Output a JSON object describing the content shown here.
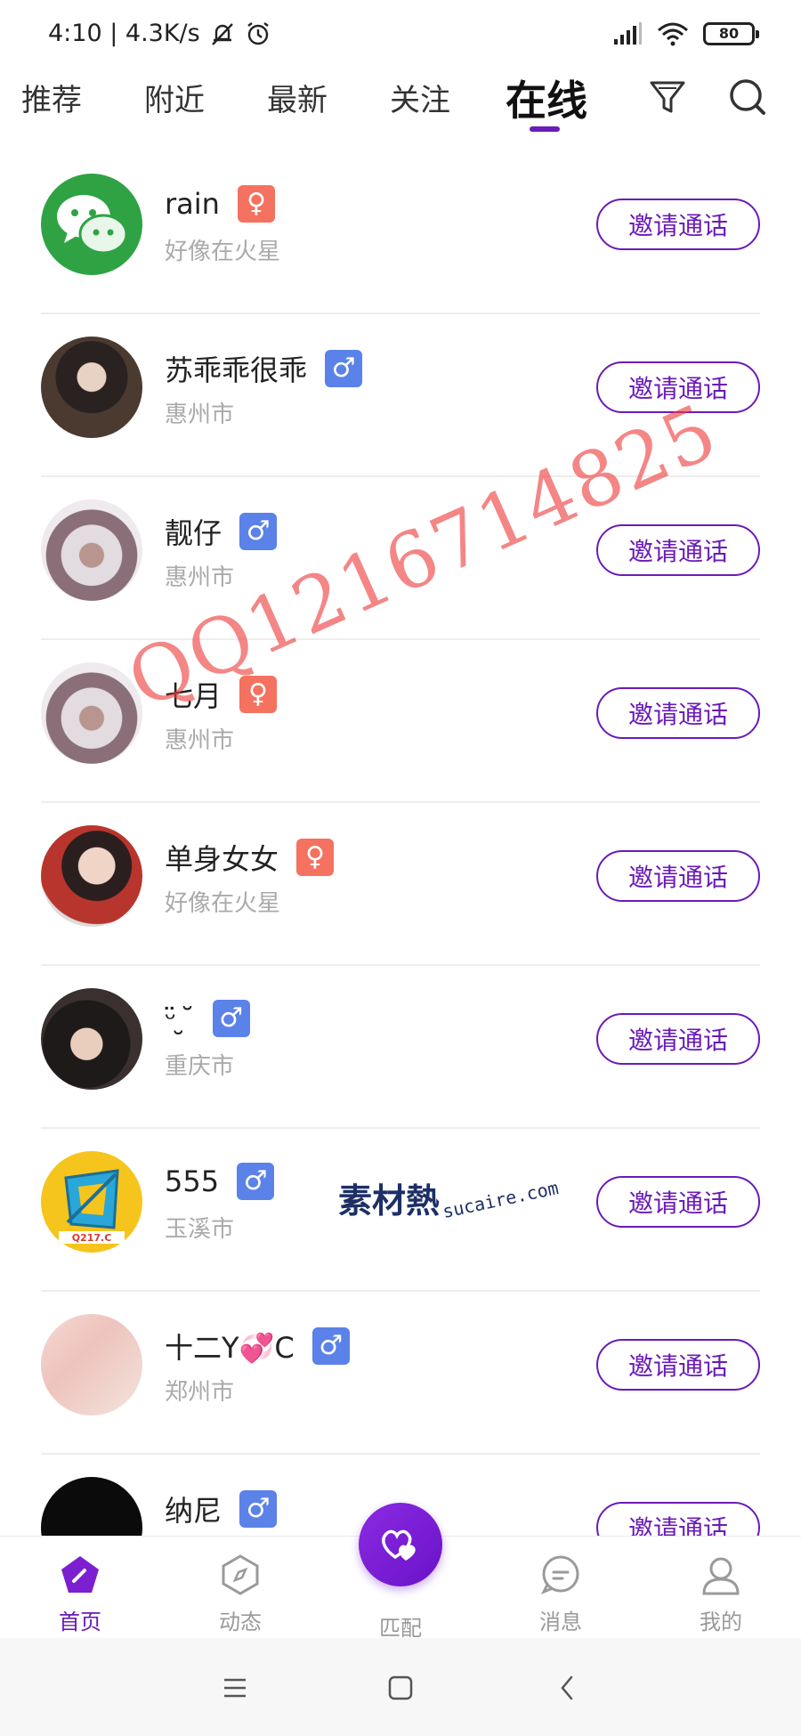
{
  "status_bar": {
    "left": "4:10 | 4.3K/s",
    "battery": "80"
  },
  "tabs": [
    {
      "label": "推荐"
    },
    {
      "label": "附近"
    },
    {
      "label": "最新"
    },
    {
      "label": "关注"
    },
    {
      "label": "在线",
      "active": true
    }
  ],
  "invite_label": "邀请通话",
  "users": [
    {
      "name": "rain",
      "gender": "female",
      "badge": "♀",
      "location": "好像在火星"
    },
    {
      "name": "苏乖乖很乖",
      "gender": "male",
      "badge": "♂",
      "location": "惠州市"
    },
    {
      "name": "靓仔",
      "gender": "male",
      "badge": "♂",
      "location": "惠州市"
    },
    {
      "name": "七月",
      "gender": "female",
      "badge": "♀",
      "location": "惠州市"
    },
    {
      "name": "单身女女",
      "gender": "female",
      "badge": "♀",
      "location": "好像在火星"
    },
    {
      "name": "ᵕ̈ ̮ ̆",
      "gender": "male",
      "badge": "♂",
      "location": "重庆市"
    },
    {
      "name": "555",
      "gender": "male",
      "badge": "♂",
      "location": "玉溪市"
    },
    {
      "name": "十二Y💞C",
      "gender": "male",
      "badge": "♂",
      "location": "郑州市"
    },
    {
      "name": "纳尼",
      "gender": "male",
      "badge": "♂",
      "location": ""
    }
  ],
  "watermarks": {
    "phone": "QQ1216714825",
    "logo_cn": "素材熱",
    "logo_en": "sucaire.com"
  },
  "bottom_nav": [
    {
      "label": "首页",
      "icon": "home-icon",
      "active": true
    },
    {
      "label": "动态",
      "icon": "compass-icon"
    },
    {
      "label": "匹配",
      "icon": "hearts-icon"
    },
    {
      "label": "消息",
      "icon": "message-icon"
    },
    {
      "label": "我的",
      "icon": "profile-icon"
    }
  ],
  "colors": {
    "accent": "#6a1bb8",
    "female_badge": "#f4725f",
    "male_badge": "#5b82e8"
  }
}
